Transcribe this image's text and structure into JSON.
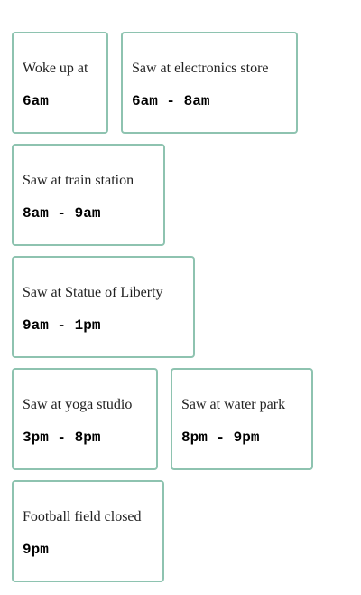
{
  "cards": [
    {
      "label": "Woke up at",
      "time": "6am"
    },
    {
      "label": "Saw at electronics store",
      "time": "6am - 8am"
    },
    {
      "label": "Saw at train station",
      "time": "8am - 9am"
    },
    {
      "label": "Saw at Statue of Liberty",
      "time": "9am - 1pm"
    },
    {
      "label": "Saw at yoga studio",
      "time": "3pm - 8pm"
    },
    {
      "label": "Saw at water park",
      "time": "8pm - 9pm"
    },
    {
      "label": "Football field closed",
      "time": "9pm"
    }
  ],
  "colors": {
    "card_border": "#8ec3b0",
    "text": "#222222"
  }
}
